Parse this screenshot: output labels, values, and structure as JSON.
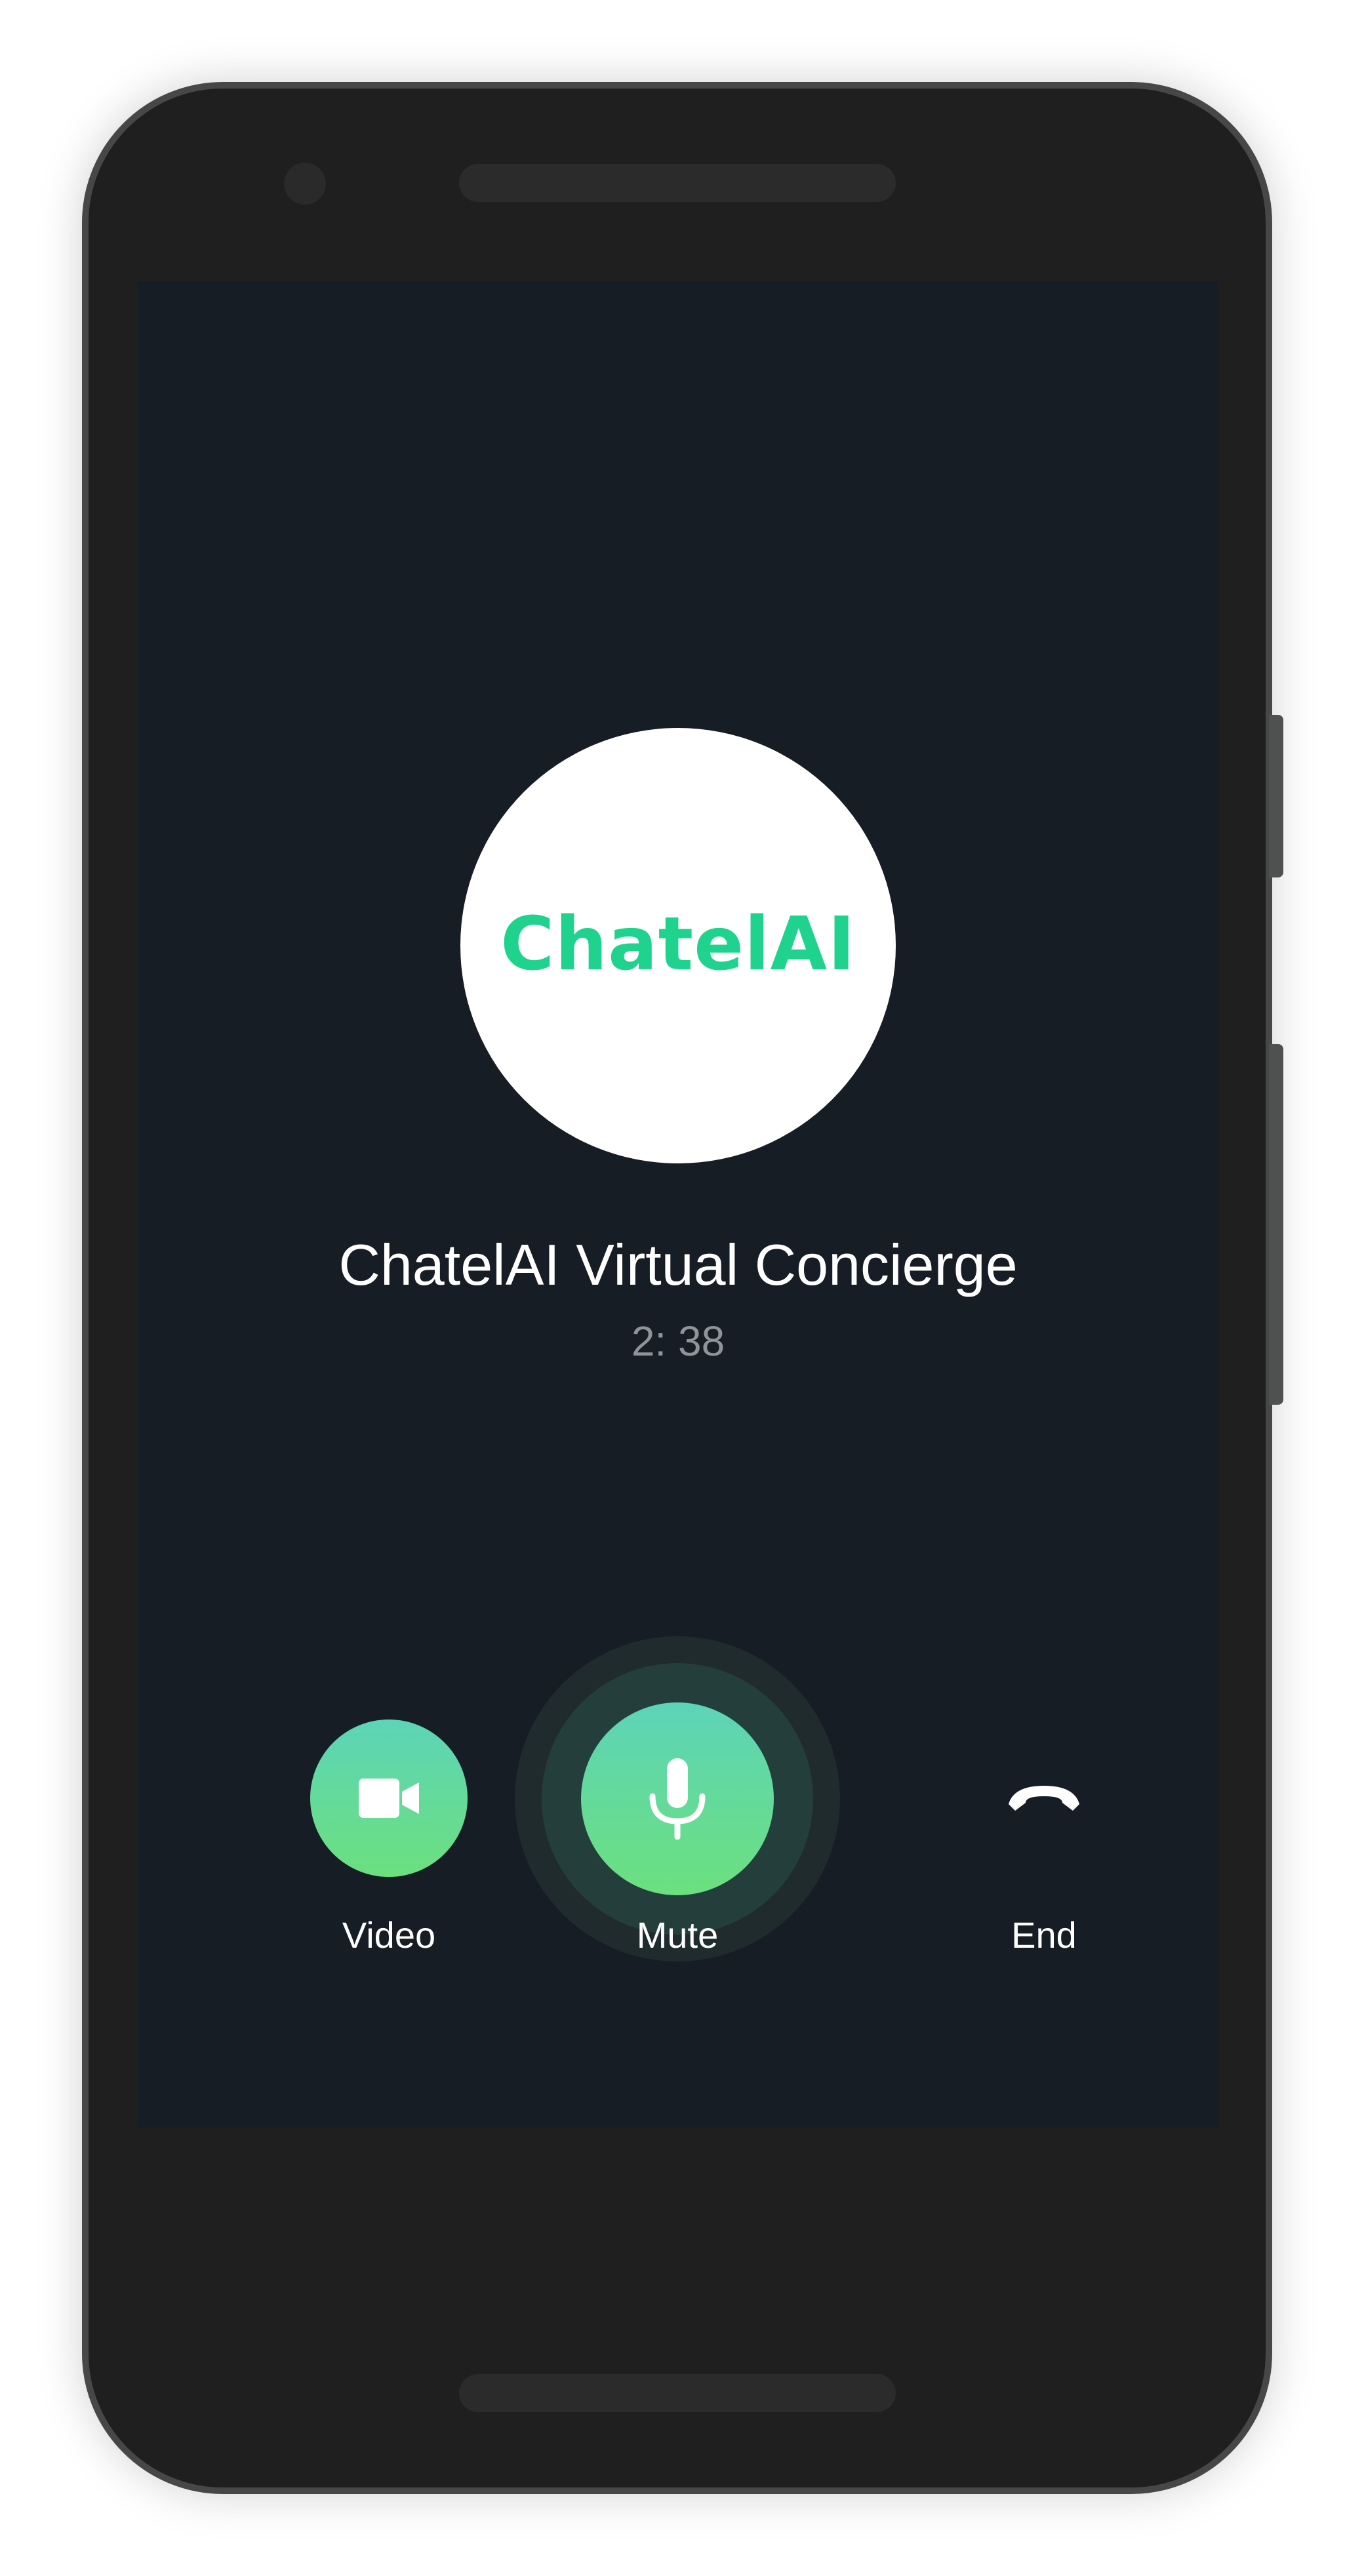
{
  "brand": {
    "logo_text": "ChatelAI",
    "logo_color": "#1fd38f",
    "screen_background": "#171d24",
    "accent_gradient": [
      "#5dd4b8",
      "#6be07e"
    ]
  },
  "call": {
    "caller_name": "ChatelAI Virtual Concierge",
    "timer": "2: 38"
  },
  "controls": {
    "video": {
      "label": "Video",
      "icon": "video-camera-icon"
    },
    "mute": {
      "label": "Mute",
      "icon": "microphone-icon"
    },
    "end": {
      "label": "End",
      "icon": "phone-hangup-icon"
    }
  }
}
